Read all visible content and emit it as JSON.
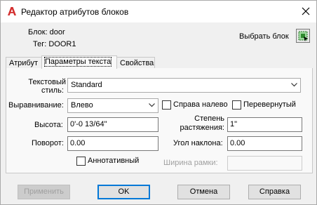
{
  "window": {
    "title": "Редактор атрибутов блоков"
  },
  "block_info": {
    "block_label": "Блок: door",
    "tag_label": "Тег: DOOR1"
  },
  "select_block": {
    "label": "Выбрать блок"
  },
  "tabs": [
    {
      "label": "Атрибут"
    },
    {
      "label": "Параметры текста"
    },
    {
      "label": "Свойства"
    }
  ],
  "text_options": {
    "text_style_label_line1": "Текстовый",
    "text_style_label_line2": "стиль:",
    "text_style_value": "Standard",
    "justification_label": "Выравнивание:",
    "justification_value": "Влево",
    "backwards_label": "Справа налево",
    "upside_down_label": "Перевернутый",
    "height_label": "Высота:",
    "height_value": "0'-0 13/64\"",
    "width_factor_label_line1": "Степень",
    "width_factor_label_line2": "растяжения:",
    "width_factor_value": "1\"",
    "rotation_label": "Поворот:",
    "rotation_value": "0.00",
    "oblique_label": "Угол наклона:",
    "oblique_value": "0.00",
    "annotative_label": "Аннотативный",
    "boundary_width_label": "Ширина рамки:",
    "boundary_width_value": ""
  },
  "buttons": {
    "apply": "Применить",
    "ok": "OK",
    "cancel": "Отмена",
    "help": "Справка"
  },
  "colors": {
    "autocad_red": "#d32f2f",
    "default_button_border": "#0078d7"
  }
}
